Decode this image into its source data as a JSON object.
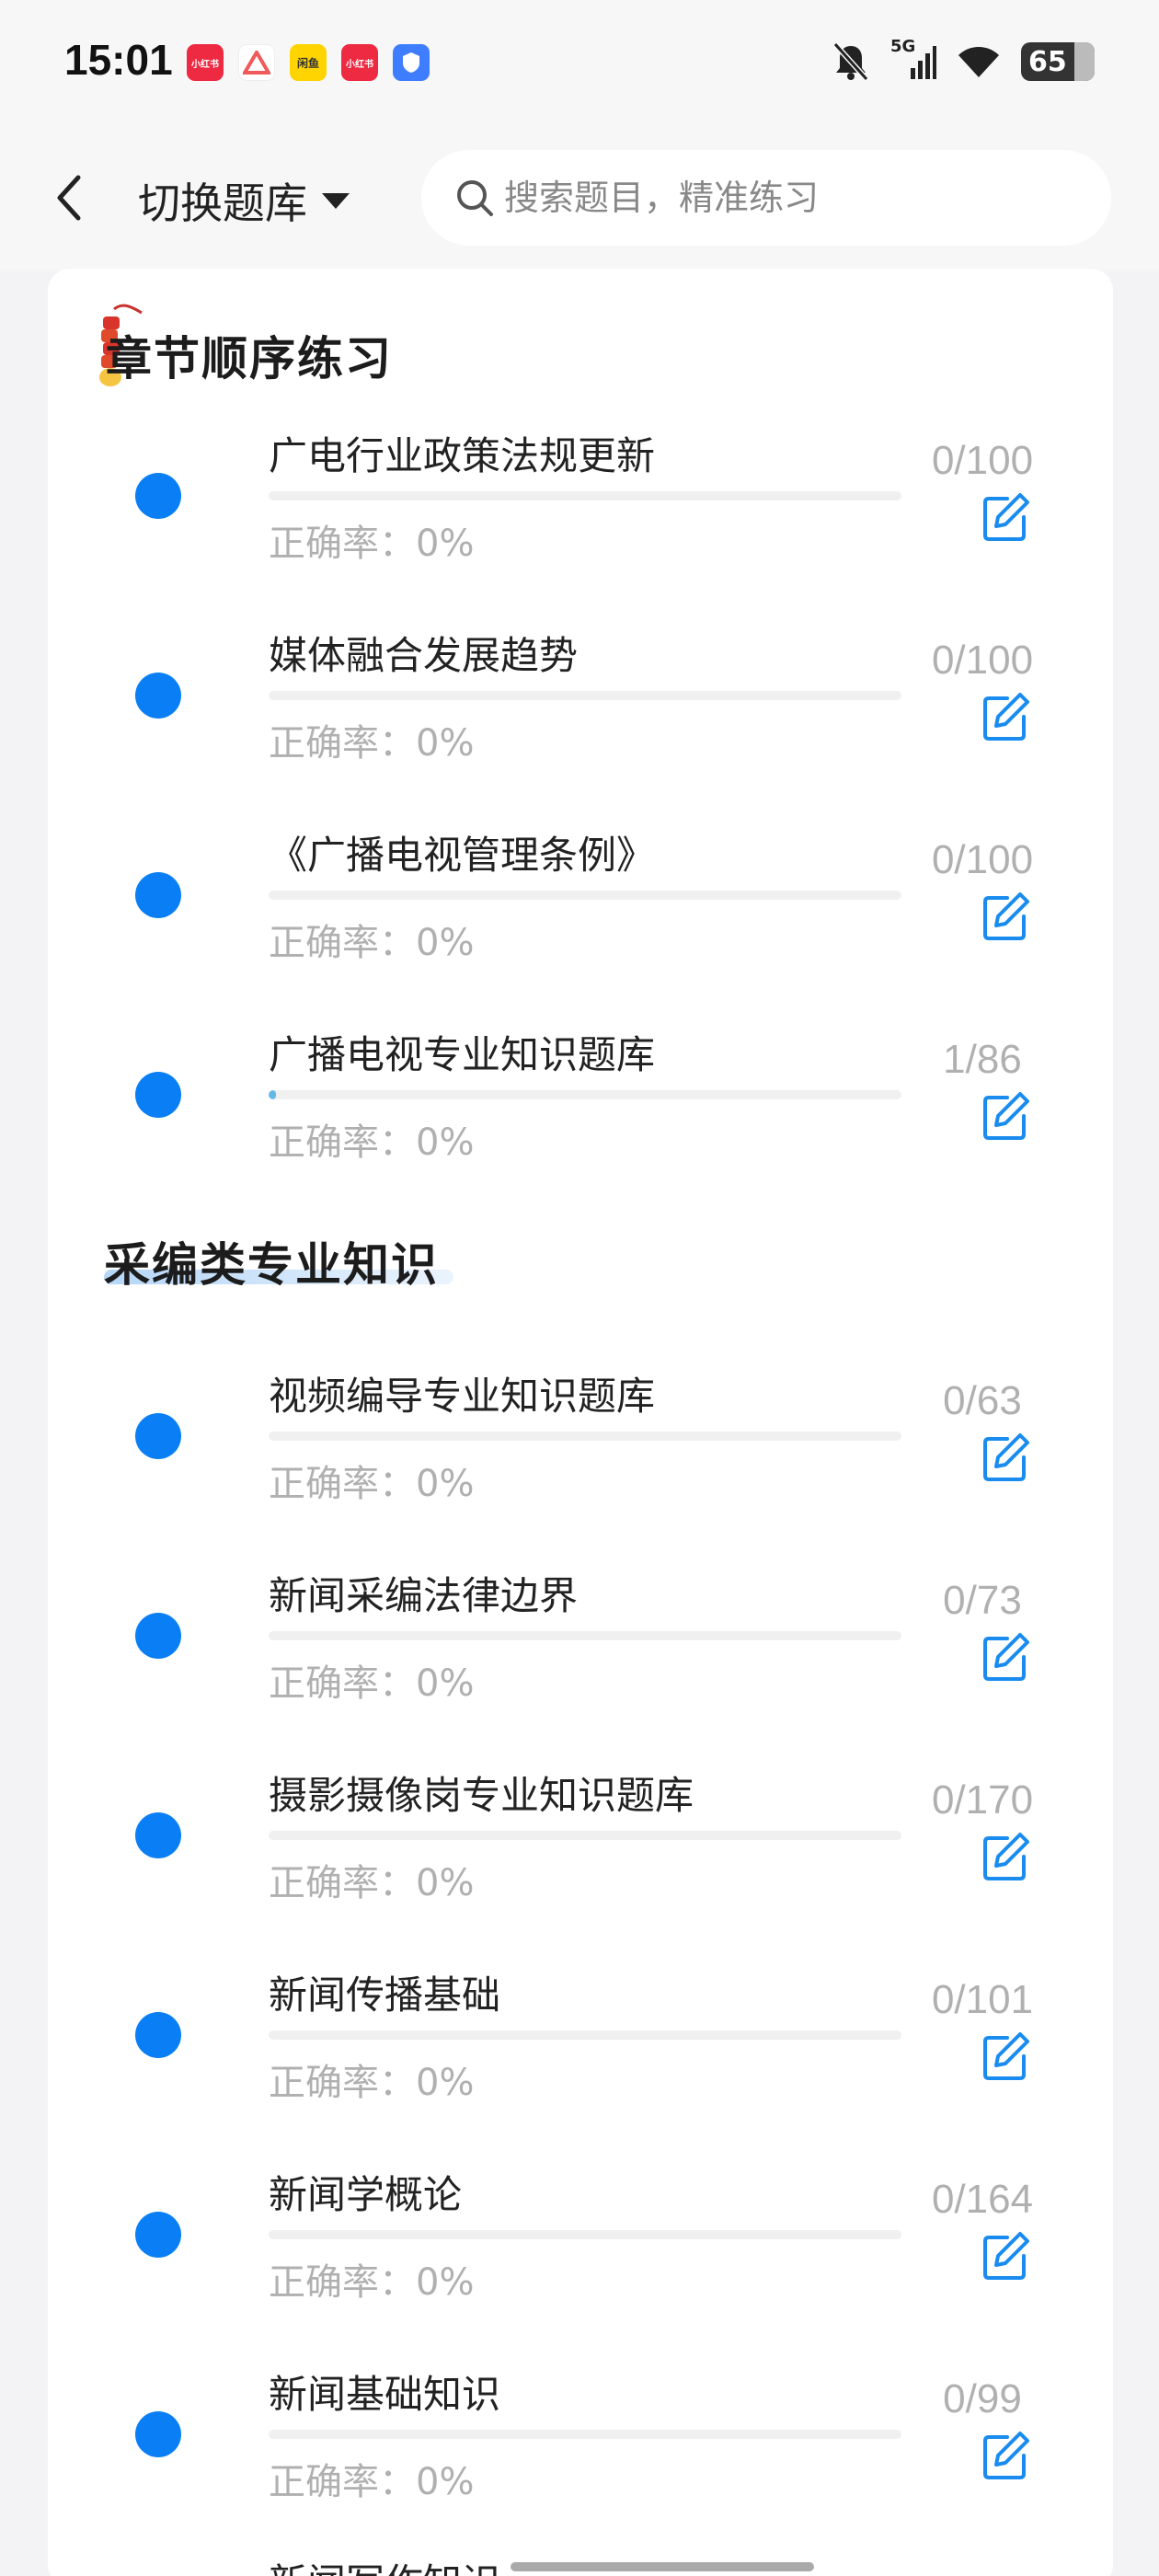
{
  "status_bar": {
    "time": "15:01",
    "apps": [
      {
        "label": "小红书",
        "color": "#ee2a42"
      },
      {
        "label": "",
        "color": "#f05a5a"
      },
      {
        "label": "闲鱼",
        "color": "#ffd400"
      },
      {
        "label": "小红书",
        "color": "#ee2a42"
      },
      {
        "label": "",
        "color": "#3f7dff"
      }
    ],
    "network": "5G",
    "battery": "65"
  },
  "header": {
    "switch_label": "切换题库",
    "search_placeholder": "搜索题目，精准练习"
  },
  "sections": [
    {
      "title": "章节顺序练习",
      "items": [
        {
          "name": "广电行业政策法规更新",
          "progress": 0.0,
          "count": "0/100",
          "rate": "正确率：0%"
        },
        {
          "name": "媒体融合发展趋势",
          "progress": 0.0,
          "count": "0/100",
          "rate": "正确率：0%"
        },
        {
          "name": "《广播电视管理条例》",
          "progress": 0.0,
          "count": "0/100",
          "rate": "正确率：0%"
        },
        {
          "name": "广播电视专业知识题库",
          "progress": 0.0116,
          "count": "1/86",
          "rate": "正确率：0%"
        }
      ]
    },
    {
      "title": "采编类专业知识",
      "items": [
        {
          "name": "视频编导专业知识题库",
          "progress": 0.0,
          "count": "0/63",
          "rate": "正确率：0%"
        },
        {
          "name": "新闻采编法律边界",
          "progress": 0.0,
          "count": "0/73",
          "rate": "正确率：0%"
        },
        {
          "name": "摄影摄像岗专业知识题库",
          "progress": 0.0,
          "count": "0/170",
          "rate": "正确率：0%"
        },
        {
          "name": "新闻传播基础",
          "progress": 0.0,
          "count": "0/101",
          "rate": "正确率：0%"
        },
        {
          "name": "新闻学概论",
          "progress": 0.0,
          "count": "0/164",
          "rate": "正确率：0%"
        },
        {
          "name": "新闻基础知识",
          "progress": 0.0,
          "count": "0/99",
          "rate": "正确率：0%"
        }
      ]
    }
  ],
  "partial_next": "新闻写作知识"
}
